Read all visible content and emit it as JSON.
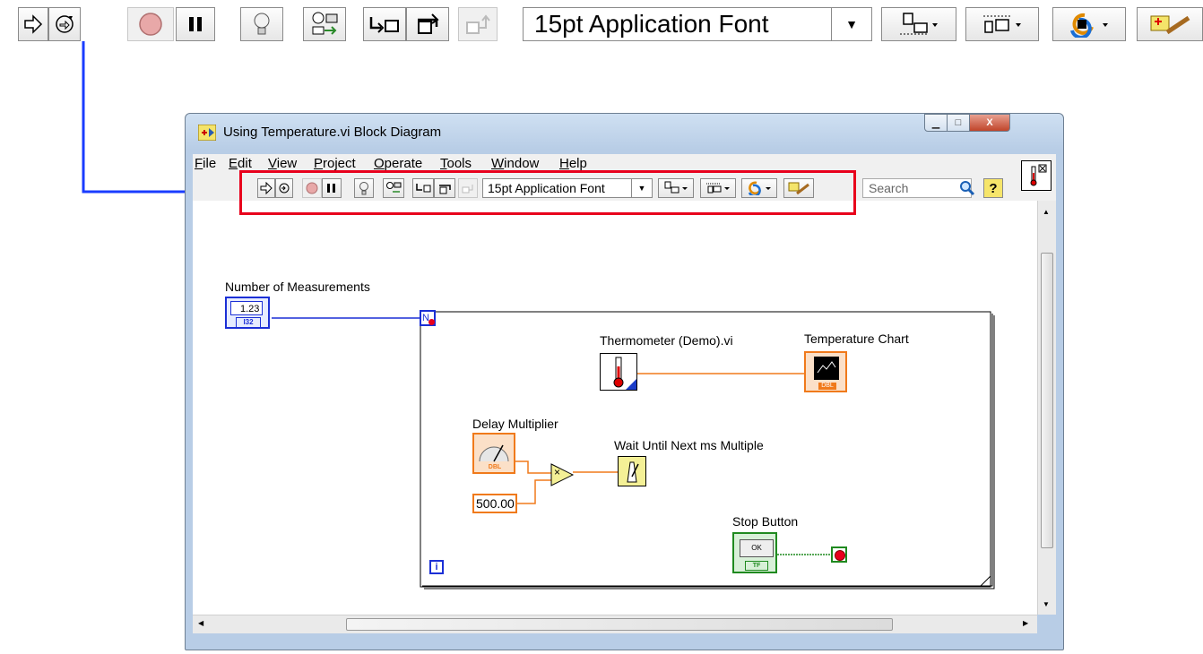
{
  "big_toolbar": {
    "font_label": "15pt Application Font"
  },
  "window": {
    "title": "Using Temperature.vi Block Diagram",
    "menu": [
      {
        "label": "File",
        "u": "F",
        "rest": "ile"
      },
      {
        "label": "Edit",
        "u": "E",
        "rest": "dit"
      },
      {
        "label": "View",
        "u": "V",
        "rest": "iew"
      },
      {
        "label": "Project",
        "u": "P",
        "rest": "roject"
      },
      {
        "label": "Operate",
        "u": "O",
        "rest": "perate"
      },
      {
        "label": "Tools",
        "u": "T",
        "rest": "ools"
      },
      {
        "label": "Window",
        "u": "W",
        "rest": "indow"
      },
      {
        "label": "Help",
        "u": "H",
        "rest": "elp"
      }
    ],
    "toolbar": {
      "font_label": "15pt Application Font",
      "search_placeholder": "Search",
      "help_label": "?"
    }
  },
  "diagram": {
    "n_control_label": "Number of Measurements",
    "n_control_value": "1.23",
    "n_control_type": "I32",
    "loop_count": "N",
    "loop_iter": "i",
    "thermo_label": "Thermometer (Demo).vi",
    "chart_label": "Temperature Chart",
    "chart_type": "DBL",
    "delay_label": "Delay Multiplier",
    "delay_type": "DBL",
    "constant_value": "500.00",
    "multiply_symbol": "×",
    "wait_label": "Wait Until Next ms Multiple",
    "stop_label": "Stop Button",
    "stop_button_text": "OK",
    "stop_type": "TF"
  },
  "colors": {
    "highlight": "#e8001c",
    "arrow": "#1a3cff",
    "int_wire": "#1b2fd6",
    "dbl_wire": "#f07a1b",
    "bool_wire": "#1f8a1f"
  }
}
